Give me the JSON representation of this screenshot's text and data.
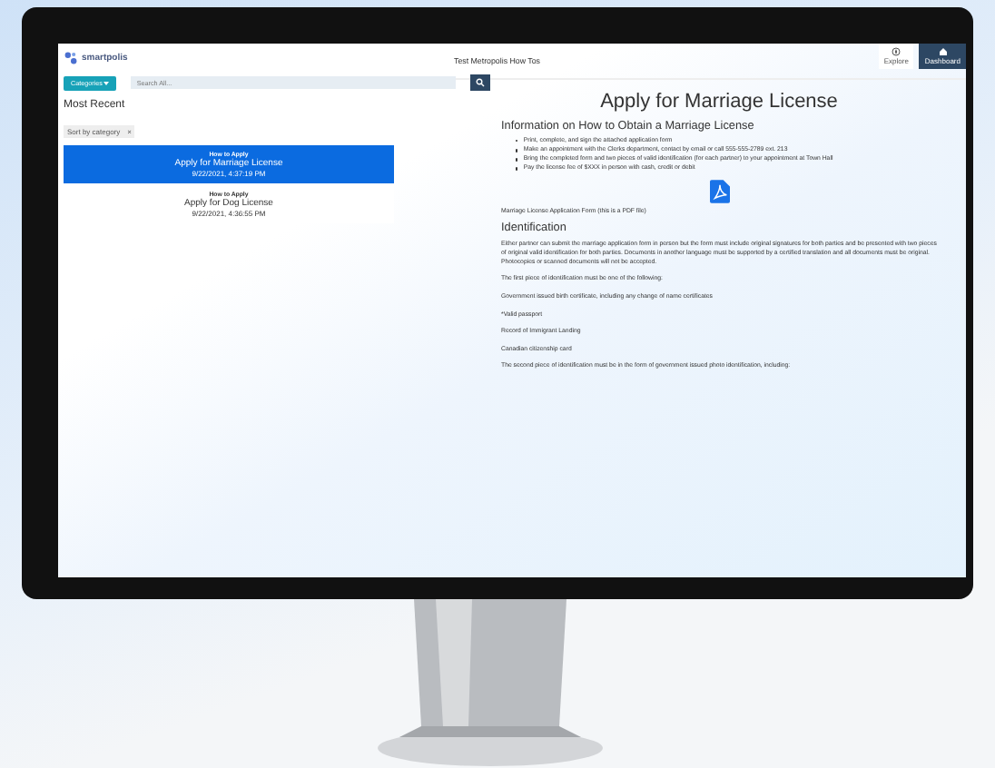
{
  "app": {
    "logo": "smartpolis",
    "title": "Test Metropolis How Tos",
    "nav_buttons": [
      {
        "label": "Explore",
        "kind": "compass",
        "selected": false
      },
      {
        "label": "Dashboard",
        "kind": "home",
        "selected": true
      }
    ]
  },
  "toolbar": {
    "categories": "Categories",
    "search": {
      "placeholder": "Search All..."
    }
  },
  "sidebar": {
    "title": "Most Recent",
    "filter": {
      "label": "Sort by category",
      "clear": "×"
    },
    "items": [
      {
        "category": "How to Apply",
        "title": "Apply for Marriage License",
        "date": "9/22/2021, 4:37:19 PM",
        "selected": true
      },
      {
        "category": "How to Apply",
        "title": "Apply for Dog License",
        "date": "9/22/2021, 4:36:55 PM",
        "selected": false
      }
    ]
  },
  "article": {
    "title": "Apply for Marriage License",
    "subtitle": "Information on How to Obtain a Marriage License",
    "steps": [
      "Print, complete, and sign the attached application form",
      "Make an appointment with the Clerks department, contact by email or call 555-555-2789 ext. 213",
      "Bring the completed form and two pieces of valid identification (for each partner) to your appointment at Town Hall",
      "Pay the license fee of $XXX in person with cash, credit or debit"
    ],
    "attachment": "Marriage License Application Form (this is a PDF file)",
    "section_title": "Identification",
    "paragraphs": [
      "Either partner can submit the marriage application form in person but the form must include original signatures for both parties and be presented with two pieces of original valid identification for both parties. Documents in another language must be supported by a certified translation and all documents must be original. Photocopies or scanned documents will not be accepted.",
      "The first piece of identification must be one of the following:",
      "Government issued birth certificate, including any change of name certificates",
      "*Valid passport",
      "Record of Immigrant Landing",
      "Canadian citizenship card",
      "The second piece of identification must be in the form of government issued photo identification, including:"
    ]
  }
}
